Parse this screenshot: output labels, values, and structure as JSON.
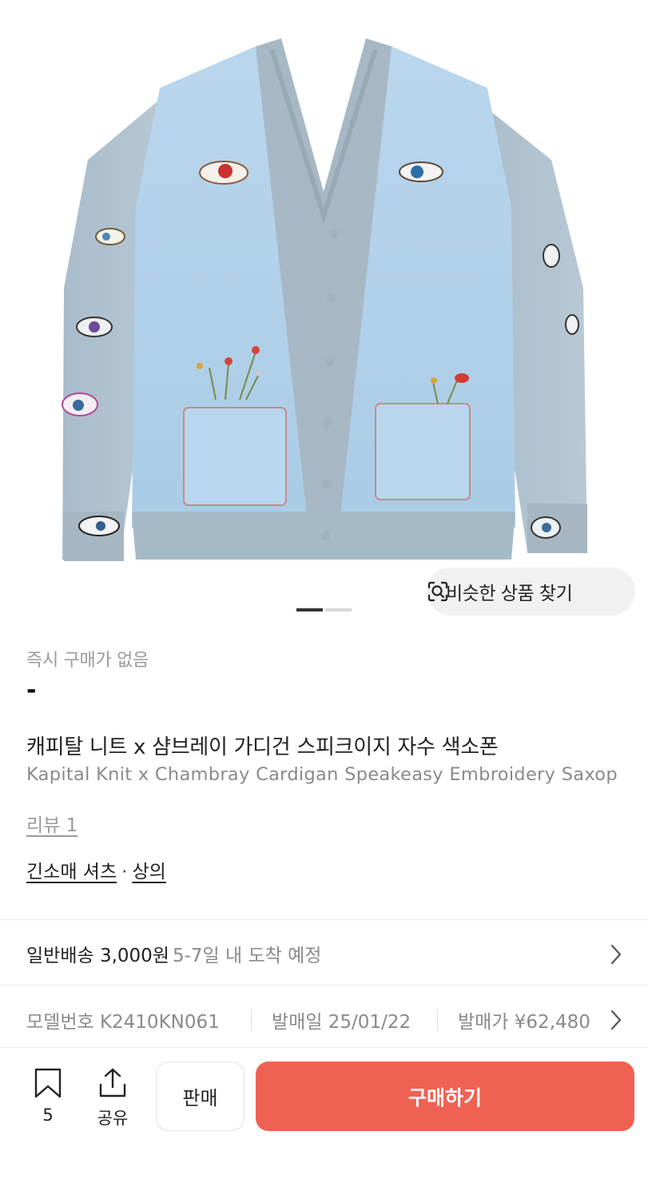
{
  "image_section": {
    "similar_label": "비슷한 상품 찾기",
    "icon": "scan-search-icon",
    "carousel_pages": 2,
    "carousel_active": 1
  },
  "product": {
    "instant_buy_status": "즉시 구매가 없음",
    "price": "-",
    "name_ko": "캐피탈 니트 x 샴브레이 가디건 스피크이지 자수 색소폰",
    "name_en": "Kapital Knit x Chambray Cardigan Speakeasy Embroidery Saxop",
    "review_label": "리뷰 1",
    "category_primary": "긴소매 셔츠",
    "category_separator": "·",
    "category_secondary": "상의"
  },
  "shipping": {
    "label": "일반배송 3,000원",
    "eta": "5-7일 내 도착 예정",
    "icon": "chevron-right-icon"
  },
  "meta": {
    "model_label": "모델번호 K2410KN061",
    "release_label": "발매일 25/01/22",
    "release_price_label": "발매가 ¥62,480",
    "icon": "chevron-right-icon"
  },
  "bottom_bar": {
    "bookmark_icon": "bookmark-icon",
    "bookmark_count": "5",
    "share_icon": "share-icon",
    "share_label": "공유",
    "sell_label": "판매",
    "buy_label": "구매하기",
    "buy_color": "#ef6253"
  }
}
